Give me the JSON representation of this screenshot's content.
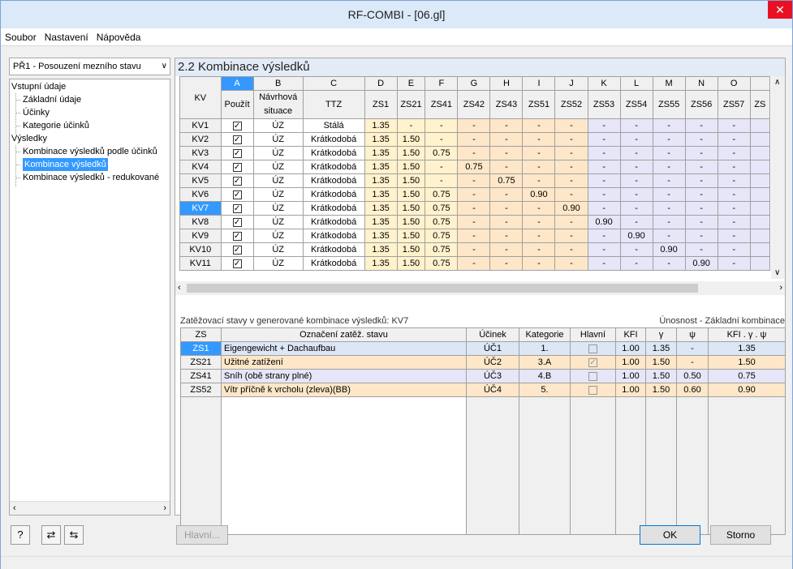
{
  "window": {
    "title": "RF-COMBI - [06.gl]",
    "close": "✕"
  },
  "menu": [
    "Soubor",
    "Nastavení",
    "Nápověda"
  ],
  "left": {
    "dropdown": "PŘ1 - Posouzení mezního stavu",
    "tree": {
      "vstupni": "Vstupní údaje",
      "zakladni": "Základní údaje",
      "ucinky": "Účinky",
      "kategorie": "Kategorie účinků",
      "vysledky": "Výsledky",
      "kvpodle": "Kombinace výsledků podle účinků",
      "kv": "Kombinace výsledků",
      "kvred": "Kombinace výsledků - redukované"
    }
  },
  "section": {
    "title": "2.2 Kombinace výsledků"
  },
  "grid": {
    "letters": [
      "A",
      "B",
      "C",
      "D",
      "E",
      "F",
      "G",
      "H",
      "I",
      "J",
      "K",
      "L",
      "M",
      "N",
      "O"
    ],
    "kv_header": "KV",
    "headers": [
      "Použít",
      "Návrhová situace",
      "TTZ",
      "ZS1",
      "ZS21",
      "ZS41",
      "ZS42",
      "ZS43",
      "ZS51",
      "ZS52",
      "ZS53",
      "ZS54",
      "ZS55",
      "ZS56",
      "ZS57",
      "ZS"
    ],
    "rows": [
      {
        "kv": "KV1",
        "b": "ÚZ",
        "c": "Stálá",
        "v": [
          "1.35",
          "-",
          "-",
          "-",
          "-",
          "-",
          "-",
          "-",
          "-",
          "-",
          "-",
          "-"
        ]
      },
      {
        "kv": "KV2",
        "b": "ÚZ",
        "c": "Krátkodobá",
        "v": [
          "1.35",
          "1.50",
          "-",
          "-",
          "-",
          "-",
          "-",
          "-",
          "-",
          "-",
          "-",
          "-"
        ]
      },
      {
        "kv": "KV3",
        "b": "ÚZ",
        "c": "Krátkodobá",
        "v": [
          "1.35",
          "1.50",
          "0.75",
          "-",
          "-",
          "-",
          "-",
          "-",
          "-",
          "-",
          "-",
          "-"
        ]
      },
      {
        "kv": "KV4",
        "b": "ÚZ",
        "c": "Krátkodobá",
        "v": [
          "1.35",
          "1.50",
          "-",
          "0.75",
          "-",
          "-",
          "-",
          "-",
          "-",
          "-",
          "-",
          "-"
        ]
      },
      {
        "kv": "KV5",
        "b": "ÚZ",
        "c": "Krátkodobá",
        "v": [
          "1.35",
          "1.50",
          "-",
          "-",
          "0.75",
          "-",
          "-",
          "-",
          "-",
          "-",
          "-",
          "-"
        ]
      },
      {
        "kv": "KV6",
        "b": "ÚZ",
        "c": "Krátkodobá",
        "v": [
          "1.35",
          "1.50",
          "0.75",
          "-",
          "-",
          "0.90",
          "-",
          "-",
          "-",
          "-",
          "-",
          "-"
        ]
      },
      {
        "kv": "KV7",
        "b": "ÚZ",
        "c": "Krátkodobá",
        "v": [
          "1.35",
          "1.50",
          "0.75",
          "-",
          "-",
          "-",
          "0.90",
          "-",
          "-",
          "-",
          "-",
          "-"
        ]
      },
      {
        "kv": "KV8",
        "b": "ÚZ",
        "c": "Krátkodobá",
        "v": [
          "1.35",
          "1.50",
          "0.75",
          "-",
          "-",
          "-",
          "-",
          "0.90",
          "-",
          "-",
          "-",
          "-"
        ]
      },
      {
        "kv": "KV9",
        "b": "ÚZ",
        "c": "Krátkodobá",
        "v": [
          "1.35",
          "1.50",
          "0.75",
          "-",
          "-",
          "-",
          "-",
          "-",
          "0.90",
          "-",
          "-",
          "-"
        ]
      },
      {
        "kv": "KV10",
        "b": "ÚZ",
        "c": "Krátkodobá",
        "v": [
          "1.35",
          "1.50",
          "0.75",
          "-",
          "-",
          "-",
          "-",
          "-",
          "-",
          "0.90",
          "-",
          "-"
        ]
      },
      {
        "kv": "KV11",
        "b": "ÚZ",
        "c": "Krátkodobá",
        "v": [
          "1.35",
          "1.50",
          "0.75",
          "-",
          "-",
          "-",
          "-",
          "-",
          "-",
          "-",
          "0.90",
          "-"
        ]
      }
    ],
    "check": "✓"
  },
  "bottom": {
    "title": "Zatěžovací stavy v generované kombinace výsledků: KV7",
    "title_right": "Únosnost - Základní kombinace",
    "headers": [
      "ZS",
      "Označení zatěž. stavu",
      "Účinek",
      "Kategorie",
      "Hlavní",
      "KFI",
      "γ",
      "ψ",
      "KFI . γ . ψ"
    ],
    "rows": [
      {
        "zs": "ZS1",
        "name": "Eigengewicht + Dachaufbau",
        "ucinek": "ÚČ1",
        "kat": "1.",
        "hlavni": "",
        "kfi": "1.00",
        "g": "1.35",
        "psi": "-",
        "prod": "1.35"
      },
      {
        "zs": "ZS21",
        "name": "Užitné zatížení",
        "ucinek": "ÚČ2",
        "kat": "3.A",
        "hlavni": "✓",
        "kfi": "1.00",
        "g": "1.50",
        "psi": "-",
        "prod": "1.50"
      },
      {
        "zs": "ZS41",
        "name": "Sníh (obě strany plné)",
        "ucinek": "ÚČ3",
        "kat": "4.B",
        "hlavni": "",
        "kfi": "1.00",
        "g": "1.50",
        "psi": "0.50",
        "prod": "0.75"
      },
      {
        "zs": "ZS52",
        "name": "Vítr příčně k vrcholu (zleva)(BB)",
        "ucinek": "ÚČ4",
        "kat": "5.",
        "hlavni": "",
        "kfi": "1.00",
        "g": "1.50",
        "psi": "0.60",
        "prod": "0.90"
      }
    ]
  },
  "buttons": {
    "hlavni": "Hlavní...",
    "ok": "OK",
    "storno": "Storno"
  },
  "icons": {
    "help": "?",
    "export": "⇄",
    "import": "⇆"
  }
}
